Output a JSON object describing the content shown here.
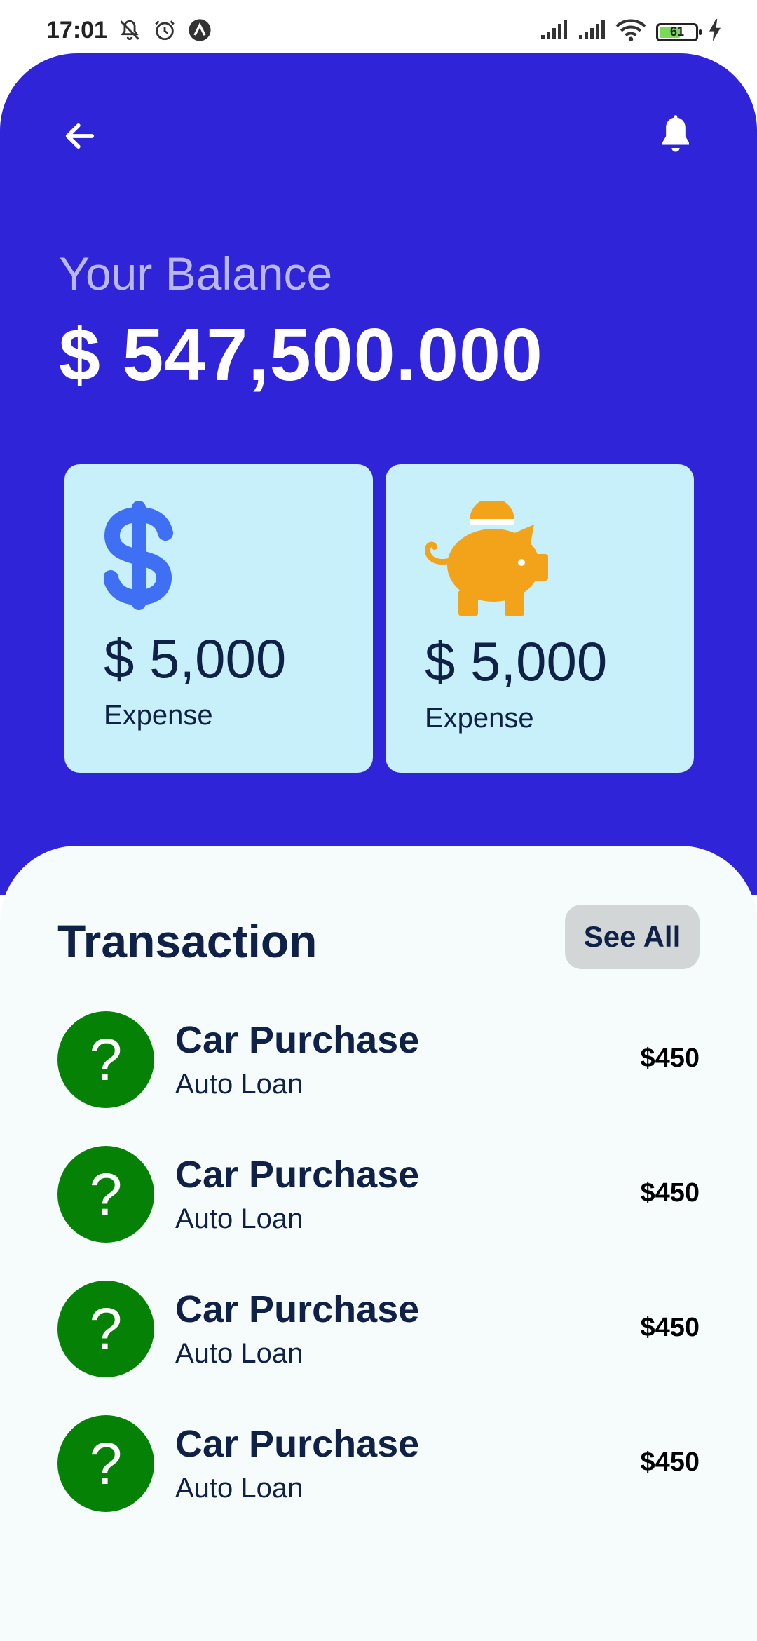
{
  "status_bar": {
    "time": "17:01",
    "battery": "61",
    "battery_level": 0.61
  },
  "header": {
    "back_icon": "arrow-left-icon",
    "notification_icon": "bell-icon"
  },
  "balance": {
    "label": "Your Balance",
    "value": "$ 547,500.000"
  },
  "cards": [
    {
      "icon": "dollar-sign-icon",
      "amount": "$ 5,000",
      "caption": "Expense",
      "icon_color": "#3f6ff2"
    },
    {
      "icon": "piggy-bank-icon",
      "amount": "$ 5,000",
      "caption": "Expense",
      "icon_color": "#f2a31a"
    }
  ],
  "transactions": {
    "title": "Transaction",
    "see_all_label": "See All",
    "items": [
      {
        "icon": "?",
        "name": "Car Purchase",
        "category": "Auto Loan",
        "amount": "$450"
      },
      {
        "icon": "?",
        "name": "Car Purchase",
        "category": "Auto Loan",
        "amount": "$450"
      },
      {
        "icon": "?",
        "name": "Car Purchase",
        "category": "Auto Loan",
        "amount": "$450"
      },
      {
        "icon": "?",
        "name": "Car Purchase",
        "category": "Auto Loan",
        "amount": "$450"
      }
    ]
  },
  "colors": {
    "primary": "#3024d8",
    "card_bg": "#c7f0fb",
    "text_dark": "#0f2147",
    "avatar_green": "#058106",
    "sheet_bg": "#f6fbfc",
    "button_bg": "#d3d6d6"
  }
}
